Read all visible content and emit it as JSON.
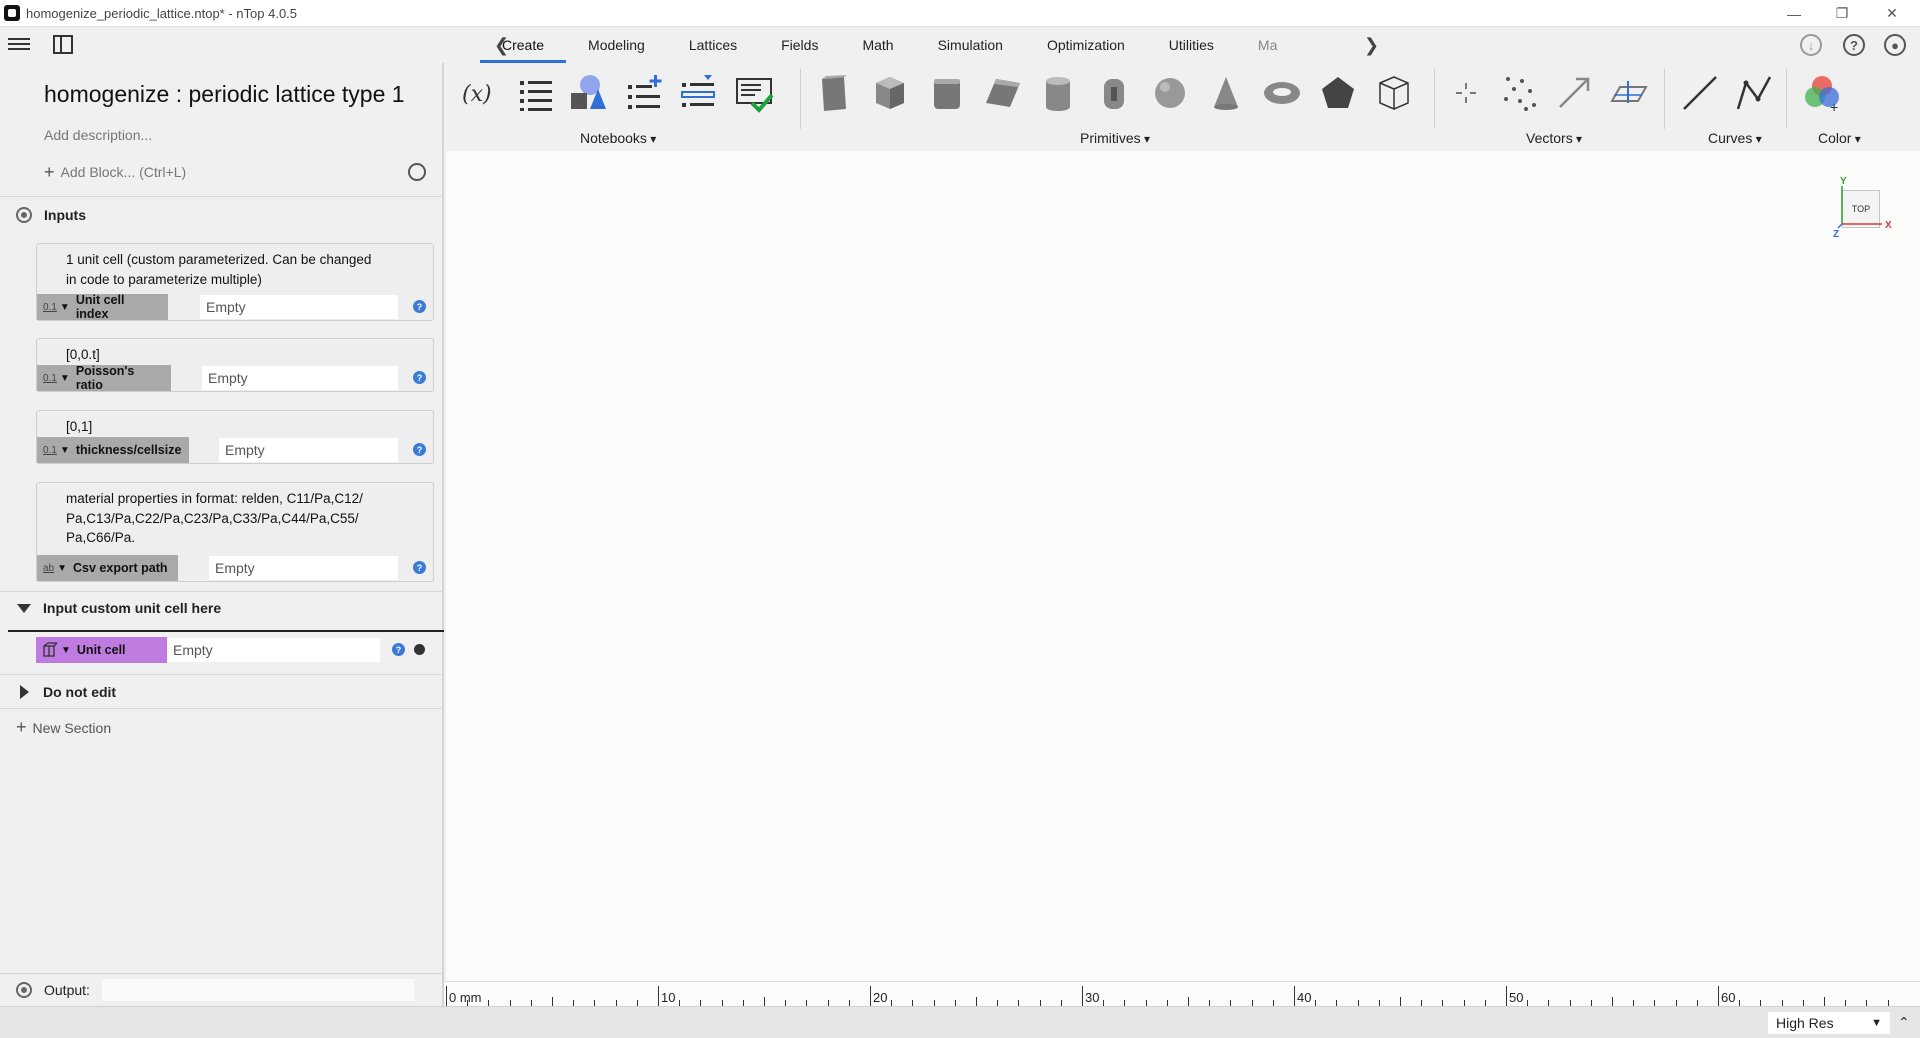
{
  "window": {
    "title": "homogenize_periodic_lattice.ntop* - nTop 4.0.5"
  },
  "ribbon_tabs": [
    "Create",
    "Modeling",
    "Lattices",
    "Fields",
    "Math",
    "Simulation",
    "Optimization",
    "Utilities",
    "Ma"
  ],
  "active_tab": "Create",
  "ribbon_groups": {
    "notebooks": "Notebooks",
    "primitives": "Primitives",
    "vectors": "Vectors",
    "curves": "Curves",
    "color": "Color"
  },
  "notebook": {
    "title": "homogenize : periodic lattice type 1",
    "description_placeholder": "Add description...",
    "add_block": "Add Block... (Ctrl+L)"
  },
  "sections": {
    "inputs": "Inputs",
    "custom": "Input custom unit cell here",
    "donotedit": "Do not edit",
    "new_section": "New Section"
  },
  "inputs": [
    {
      "desc_lines": [
        "1 unit cell (custom parameterized. Can be changed",
        "in code to parameterize multiple)"
      ],
      "type": "0.1",
      "name": "Unit cell index",
      "value": "Empty"
    },
    {
      "desc_lines": [
        "[0,0.t]"
      ],
      "type": "0.1",
      "name": "Poisson's ratio",
      "value": "Empty"
    },
    {
      "desc_lines": [
        "[0,1]"
      ],
      "type": "0.1",
      "name": "thickness/cellsize",
      "value": "Empty"
    },
    {
      "desc_lines": [
        "material properties in format: relden, C11/Pa,C12/",
        "Pa,C13/Pa,C22/Pa,C23/Pa,C33/Pa,C44/Pa,C55/",
        "Pa,C66/Pa."
      ],
      "type": "ab",
      "name": "Csv export path",
      "value": "Empty"
    }
  ],
  "unit_cell_input": {
    "name": "Unit cell",
    "value": "Empty"
  },
  "output": {
    "label": "Output:"
  },
  "viewport": {
    "navcube_label": "TOP",
    "axis_y": "Y",
    "axis_x": "X",
    "axis_z": "Z"
  },
  "ruler": {
    "labels": [
      "0 mm",
      "10",
      "20",
      "30",
      "40",
      "50",
      "60"
    ]
  },
  "status": {
    "quality": "High Res"
  },
  "colors": {
    "accent": "#2f6fd6",
    "help": "#3a7bd5",
    "unit_cell_badge": "#c07be0",
    "input_badge": "#a9a9a9"
  }
}
